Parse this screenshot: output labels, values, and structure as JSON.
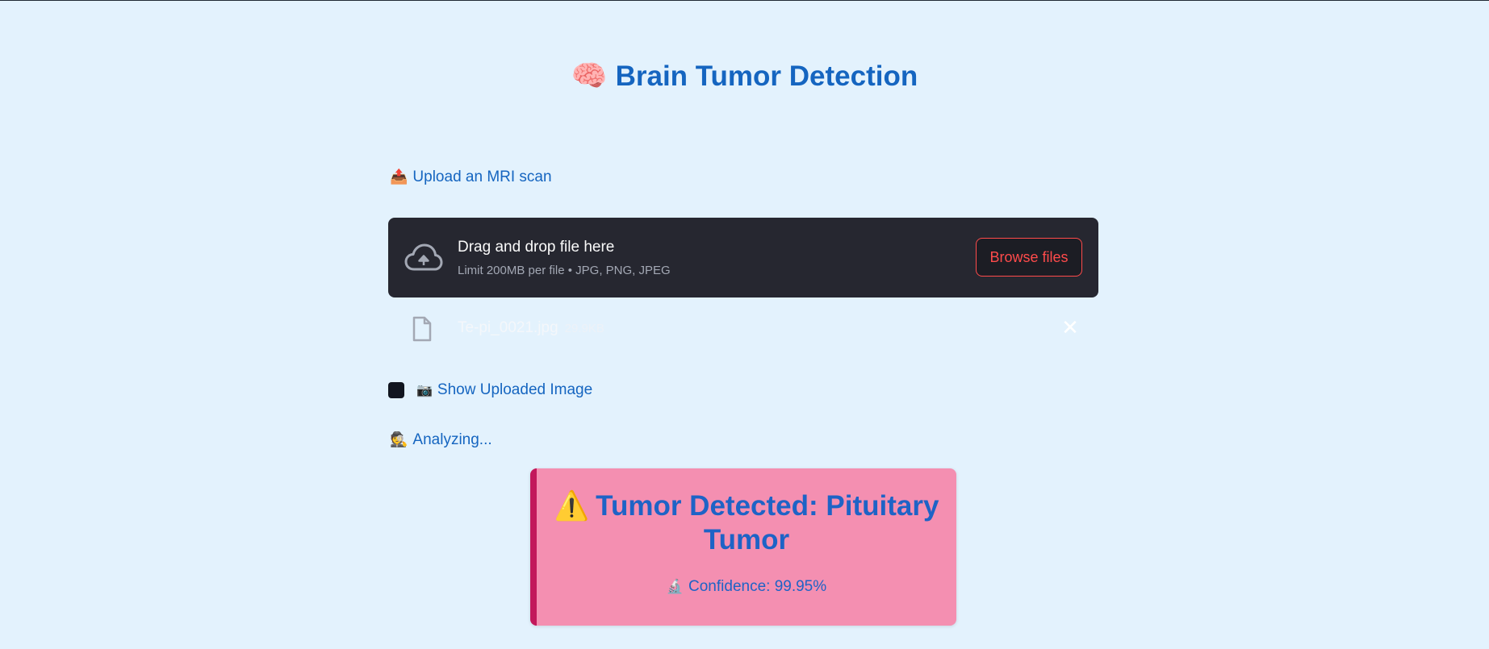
{
  "header": {
    "title_icon": "brain-icon",
    "title_emoji": "🧠",
    "title": "Brain Tumor Detection"
  },
  "uploader": {
    "label_emoji": "📤",
    "label_icon": "outbox-tray-icon",
    "label": "Upload an MRI scan",
    "dropzone_title": "Drag and drop file here",
    "dropzone_subtitle": "Limit 200MB per file • JPG, PNG, JPEG",
    "browse_label": "Browse files",
    "cloud_icon": "cloud-upload-icon",
    "file": {
      "icon": "file-icon",
      "name": "Te-pi_0021.jpg",
      "size": "29.9KB",
      "remove_glyph": "✕"
    }
  },
  "show_image": {
    "checked": false,
    "label_emoji": "📷",
    "label_icon": "camera-icon",
    "label": "Show Uploaded Image"
  },
  "status": {
    "emoji": "🕵️",
    "icon": "detective-icon",
    "text": "Analyzing..."
  },
  "result": {
    "warning_emoji": "⚠️",
    "warning_icon": "warning-icon",
    "title": "Tumor Detected: Pituitary Tumor",
    "confidence_emoji": "🔬",
    "confidence_icon": "microscope-icon",
    "confidence": "Confidence: 99.95%"
  },
  "colors": {
    "background": "#e3f2fd",
    "primary_text": "#1565c0",
    "dropzone": "#262730",
    "accent_red": "#ff4b4b",
    "result_card": "#f48fb1",
    "result_accent": "#c2185b"
  }
}
